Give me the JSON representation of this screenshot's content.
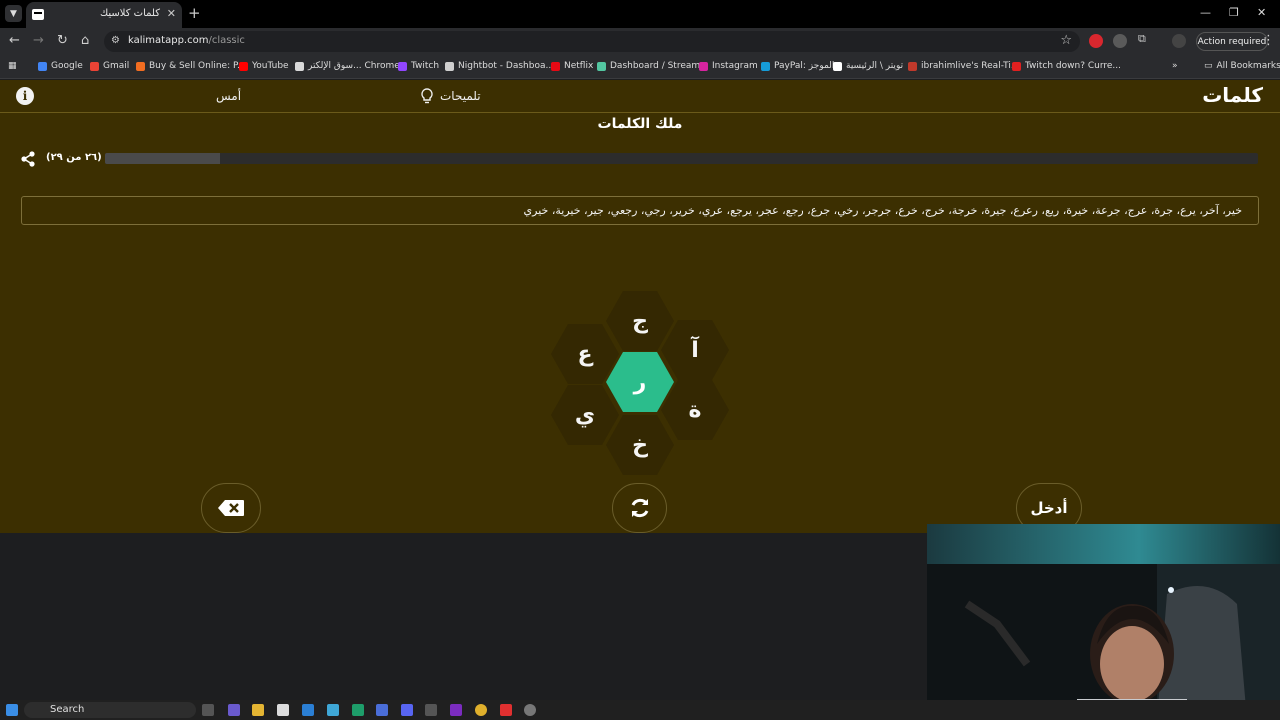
{
  "browser": {
    "tab_title": "كلمات كلاسيك",
    "url_host": "kalimatapp.com",
    "url_path": "/classic",
    "action_required": "Action required",
    "all_bookmarks": "All Bookmarks",
    "bookmarks": [
      {
        "label": "Google",
        "color": "#4285f4"
      },
      {
        "label": "Gmail",
        "color": "#ea4335"
      },
      {
        "label": "Buy & Sell Online: P...",
        "color": "#f26d21"
      },
      {
        "label": "YouTube",
        "color": "#ff0000"
      },
      {
        "label": "سوق الإلكتر... Chrome",
        "color": "#d9d9d9"
      },
      {
        "label": "Twitch",
        "color": "#9146ff"
      },
      {
        "label": "Nightbot - Dashboa...",
        "color": "#cfcfcf"
      },
      {
        "label": "Netflix",
        "color": "#e50914"
      },
      {
        "label": "Dashboard / Stream...",
        "color": "#53c6a1"
      },
      {
        "label": "Instagram",
        "color": "#d6249f"
      },
      {
        "label": "PayPal: الموجز",
        "color": "#169bd7"
      },
      {
        "label": "تويتر \\ الرئيسية",
        "color": "#ffffff"
      },
      {
        "label": "ibrahimlive's Real-Ti...",
        "color": "#c0392b"
      },
      {
        "label": "Twitch down? Curre...",
        "color": "#e02020"
      }
    ]
  },
  "header": {
    "logo": "كلمات",
    "hints_label": "تلميحات",
    "yesterday_label": "أمس"
  },
  "game": {
    "rank_title": "ملك الكلمات",
    "progress_text": "(٢٦ من ٢٩)",
    "progress_fraction": 0.1,
    "found_words": "خير، آخر، يرع، جرة، عرج، جرعة، خيرة، ريع، رعرع، جيرة، خرجة، خرج، خرع، جرجر، رخي، جرع، رجع، عجر، يرجع، عري، خرير، رجي، رجعي، جير، خيرية، خيري",
    "center_letter": "ر",
    "outer_letters": [
      "ج",
      "آ",
      "ة",
      "خ",
      "ي",
      "ع"
    ],
    "enter_label": "أدخل"
  },
  "taskbar": {
    "search_label": "Search"
  },
  "colors": {
    "app_bg": "#3c2f01",
    "hex_bg": "#342802",
    "center_hex": "#2bbd8c"
  }
}
